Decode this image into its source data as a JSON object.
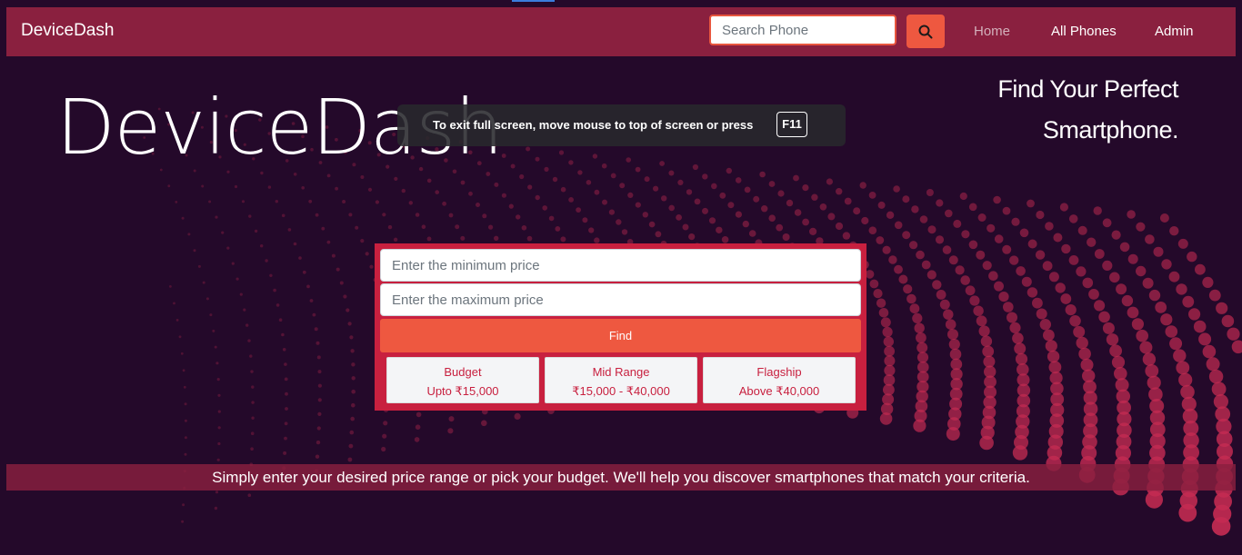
{
  "navbar": {
    "brand": "DeviceDash",
    "search_placeholder": "Search Phone",
    "search_icon": "search-icon",
    "links": [
      "Home",
      "All Phones",
      "Admin"
    ]
  },
  "hero": {
    "title": "DeviceDash",
    "tagline": "Find Your Perfect Smartphone."
  },
  "fullscreen_toast": {
    "text": "To exit full screen, move mouse to top of screen or press",
    "key": "F11"
  },
  "price_form": {
    "min_placeholder": "Enter the minimum price",
    "max_placeholder": "Enter the maximum price",
    "find_label": "Find",
    "ranges": [
      {
        "name": "Budget",
        "range": "Upto ₹15,000"
      },
      {
        "name": "Mid Range",
        "range": "₹15,000 - ₹40,000"
      },
      {
        "name": "Flagship",
        "range": "Above ₹40,000"
      }
    ]
  },
  "info_banner": "Simply enter your desired price range or pick your budget. We'll help you discover smartphones that match your criteria.",
  "colors": {
    "background": "#24092a",
    "navbar": "#8a203f",
    "accent": "#ee5840",
    "card": "#c8203f",
    "dots": "#c42b52"
  }
}
